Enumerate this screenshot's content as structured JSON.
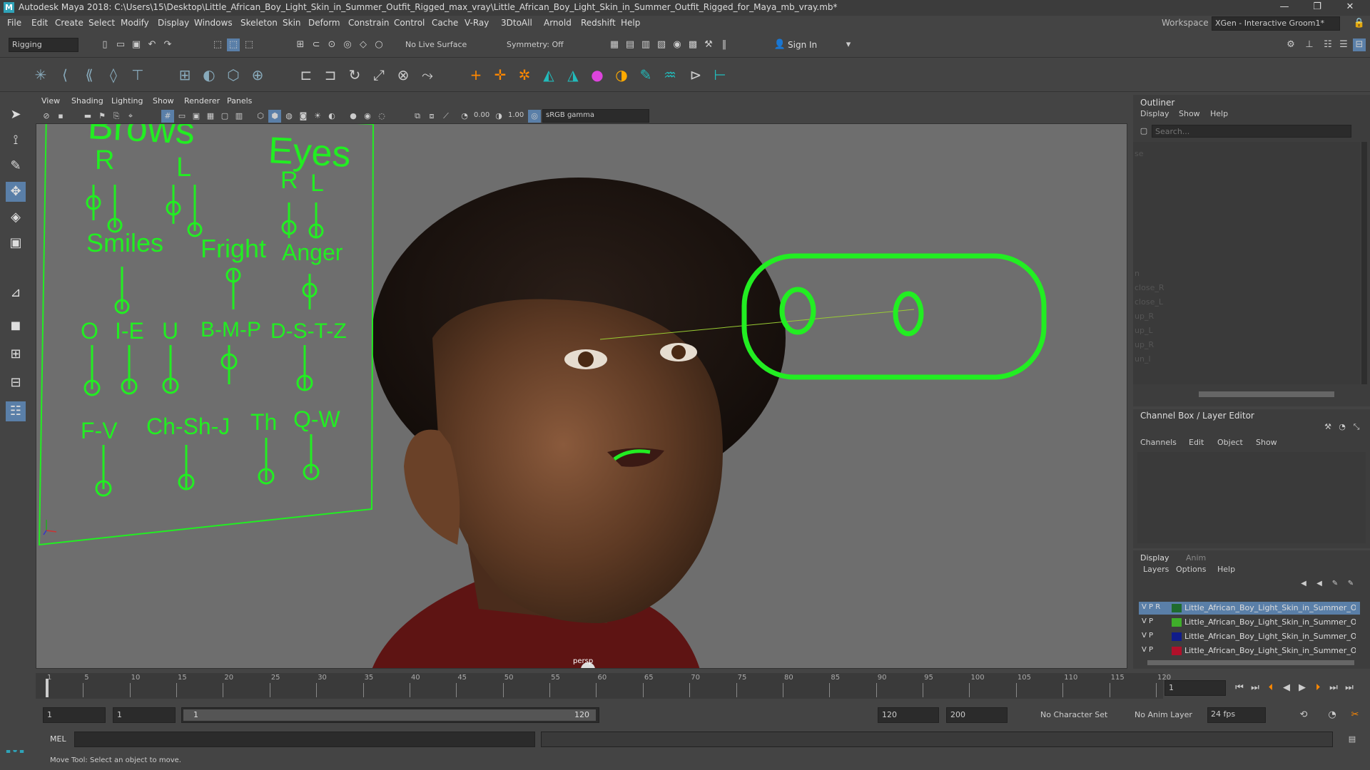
{
  "window": {
    "title": "Autodesk Maya 2018: C:\\Users\\15\\Desktop\\Little_African_Boy_Light_Skin_in_Summer_Outfit_Rigged_max_vray\\Little_African_Boy_Light_Skin_in_Summer_Outfit_Rigged_for_Maya_mb_vray.mb*",
    "minimize": "—",
    "restore": "❐",
    "close": "✕"
  },
  "menubar": [
    "File",
    "Edit",
    "Create",
    "Select",
    "Modify",
    "Display",
    "Windows",
    "Skeleton",
    "Skin",
    "Deform",
    "Constrain",
    "Control",
    "Cache",
    "V-Ray",
    "3DtoAll",
    "Arnold",
    "Redshift",
    "Help"
  ],
  "workspace": {
    "label": "Workspace :",
    "value": "XGen - Interactive Groom1*"
  },
  "statusline": {
    "mode": "Rigging",
    "live_surface": "No Live Surface",
    "symmetry": "Symmetry: Off",
    "sign_in": "Sign In"
  },
  "viewport": {
    "menus": [
      "View",
      "Shading",
      "Lighting",
      "Show",
      "Renderer",
      "Panels"
    ],
    "exposure": "0.00",
    "gamma": "1.00",
    "colorspace": "sRGB gamma",
    "camera_label": "persp"
  },
  "face_board": {
    "brows": "Brows",
    "brows_r": "R",
    "brows_l": "L",
    "eyes": "Eyes",
    "eyes_r": "R",
    "eyes_l": "L",
    "smiles": "Smiles",
    "fright": "Fright",
    "anger": "Anger",
    "o": "O",
    "ie": "I-E",
    "u": "U",
    "bmp": "B-M-P",
    "dstz": "D-S-T-Z",
    "fv": "F-V",
    "chshj": "Ch-Sh-J",
    "th": "Th",
    "qw": "Q-W"
  },
  "outliner": {
    "title": "Outliner",
    "menus": [
      "Display",
      "Show",
      "Help"
    ],
    "search_placeholder": "Search...",
    "items": [
      "n",
      "close_R",
      "close_L",
      "up_R",
      "up_L",
      "up_R",
      "un_l"
    ],
    "top_item": "se"
  },
  "channelbox": {
    "title": "Channel Box / Layer Editor",
    "menus": [
      "Channels",
      "Edit",
      "Object",
      "Show"
    ]
  },
  "layereditor": {
    "tabs": [
      "Display",
      "Anim"
    ],
    "menus": [
      "Layers",
      "Options",
      "Help"
    ],
    "layers": [
      {
        "vis": "V P R",
        "name": "Little_African_Boy_Light_Skin_in_Summer_Outfit",
        "color": "#1f6b2e",
        "selected": true
      },
      {
        "vis": "V P",
        "name": "Little_African_Boy_Light_Skin_in_Summer_Outfit",
        "color": "#3fae2a",
        "selected": false
      },
      {
        "vis": "V P",
        "name": "Little_African_Boy_Light_Skin_in_Summer_Outfit",
        "color": "#101c8a",
        "selected": false
      },
      {
        "vis": "V P",
        "name": "Little_African_Boy_Light_Skin_in_Summer_Outfi",
        "color": "#b0102a",
        "selected": false
      }
    ]
  },
  "timeline": {
    "ticks": [
      "1",
      "5",
      "10",
      "15",
      "20",
      "25",
      "30",
      "35",
      "40",
      "45",
      "50",
      "55",
      "60",
      "65",
      "70",
      "75",
      "80",
      "85",
      "90",
      "95",
      "100",
      "105",
      "110",
      "115",
      "120"
    ],
    "current_frame": "1"
  },
  "range": {
    "start": "1",
    "start2": "1",
    "slider_start": "1",
    "slider_end": "120",
    "end": "120",
    "end2": "200",
    "character_set": "No Character Set",
    "anim_layer": "No Anim Layer",
    "fps": "24 fps"
  },
  "cmdline": {
    "label": "MEL"
  },
  "helpline": {
    "text": "Move Tool: Select an object to move."
  },
  "colors": {
    "rig_green": "#22ee22",
    "viewport_bg": "#6e6e6e",
    "selected_layer": "#5a7fa8"
  }
}
